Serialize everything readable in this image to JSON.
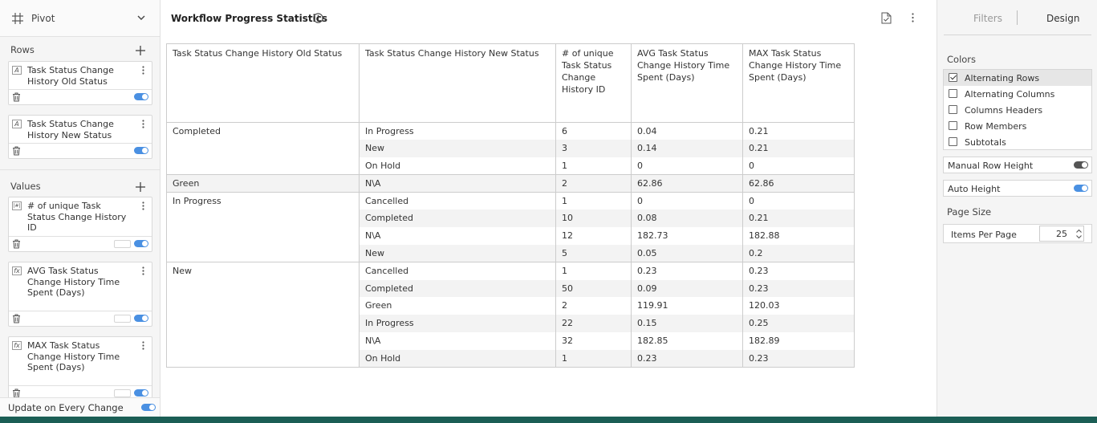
{
  "sidebar": {
    "pivot_label": "Pivot",
    "rows_title": "Rows",
    "values_title": "Values",
    "rows": [
      {
        "type_icon": "A",
        "label": "Task Status Change History Old Status"
      },
      {
        "type_icon": "A",
        "label": "Task Status Change History New Status"
      }
    ],
    "values": [
      {
        "type_icon": "|#|",
        "label": "# of unique Task Status Change History ID"
      },
      {
        "type_icon": "fx",
        "label": "AVG Task Status Change History Time Spent (Days)"
      },
      {
        "type_icon": "fx",
        "label": "MAX Task Status Change History Time Spent (Days)"
      }
    ],
    "update_label": "Update on Every Change"
  },
  "main": {
    "title": "Workflow Progress Statistics",
    "table": {
      "headers": [
        "Task Status Change History Old Status",
        "Task Status Change History New Status",
        "# of unique Task Status Change History ID",
        "AVG Task Status Change History Time Spent (Days)",
        "MAX Task Status Change History Time Spent (Days)"
      ],
      "groups": [
        {
          "old": "Completed",
          "rows": [
            {
              "new": "In Progress",
              "count": "6",
              "avg": "0.04",
              "max": "0.21"
            },
            {
              "new": "New",
              "count": "3",
              "avg": "0.14",
              "max": "0.21"
            },
            {
              "new": "On Hold",
              "count": "1",
              "avg": "0",
              "max": "0"
            }
          ]
        },
        {
          "old": "Green",
          "rows": [
            {
              "new": "N\\A",
              "count": "2",
              "avg": "62.86",
              "max": "62.86"
            }
          ]
        },
        {
          "old": "In Progress",
          "rows": [
            {
              "new": "Cancelled",
              "count": "1",
              "avg": "0",
              "max": "0"
            },
            {
              "new": "Completed",
              "count": "10",
              "avg": "0.08",
              "max": "0.21"
            },
            {
              "new": "N\\A",
              "count": "12",
              "avg": "182.73",
              "max": "182.88"
            },
            {
              "new": "New",
              "count": "5",
              "avg": "0.05",
              "max": "0.2"
            }
          ]
        },
        {
          "old": "New",
          "rows": [
            {
              "new": "Cancelled",
              "count": "1",
              "avg": "0.23",
              "max": "0.23"
            },
            {
              "new": "Completed",
              "count": "50",
              "avg": "0.09",
              "max": "0.23"
            },
            {
              "new": "Green",
              "count": "2",
              "avg": "119.91",
              "max": "120.03"
            },
            {
              "new": "In Progress",
              "count": "22",
              "avg": "0.15",
              "max": "0.25"
            },
            {
              "new": "N\\A",
              "count": "32",
              "avg": "182.85",
              "max": "182.89"
            },
            {
              "new": "On Hold",
              "count": "1",
              "avg": "0.23",
              "max": "0.23"
            }
          ]
        }
      ]
    }
  },
  "design": {
    "tabs": {
      "filters": "Filters",
      "design": "Design"
    },
    "colors_title": "Colors",
    "color_options": [
      {
        "label": "Alternating Rows",
        "checked": true
      },
      {
        "label": "Alternating Columns",
        "checked": false
      },
      {
        "label": "Columns Headers",
        "checked": false
      },
      {
        "label": "Row Members",
        "checked": false
      },
      {
        "label": "Subtotals",
        "checked": false
      }
    ],
    "manual_row_height": {
      "label": "Manual Row Height",
      "on": false
    },
    "auto_height": {
      "label": "Auto Height",
      "on": true
    },
    "page_size_title": "Page Size",
    "items_per_page_label": "Items Per Page",
    "items_per_page": "25"
  },
  "colors": {
    "accent": "#4a90e2",
    "footer": "#1b5e55",
    "alt_row": "#f3f3f3"
  }
}
